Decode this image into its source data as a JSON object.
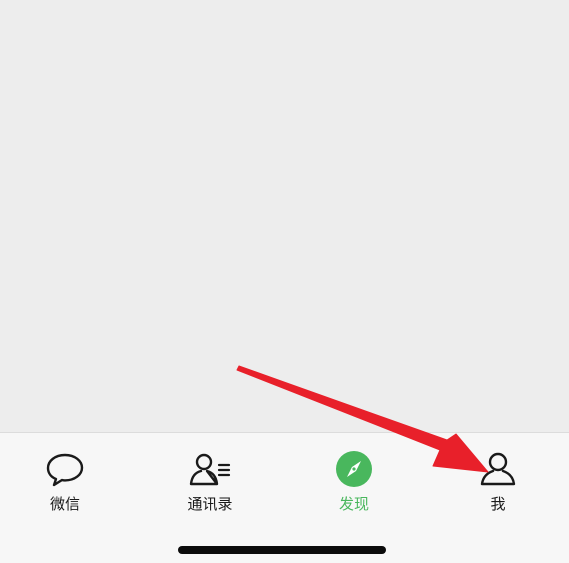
{
  "tab_bar": {
    "tabs": [
      {
        "label": "微信",
        "icon": "chat-bubble-icon",
        "active": false
      },
      {
        "label": "通讯录",
        "icon": "contacts-icon",
        "active": false
      },
      {
        "label": "发现",
        "icon": "compass-icon",
        "active": true
      },
      {
        "label": "我",
        "icon": "person-icon",
        "active": false
      }
    ]
  },
  "colors": {
    "active": "#49b75d",
    "inactive_text": "#1a1a1a",
    "annotation_arrow": "#e8202a"
  }
}
